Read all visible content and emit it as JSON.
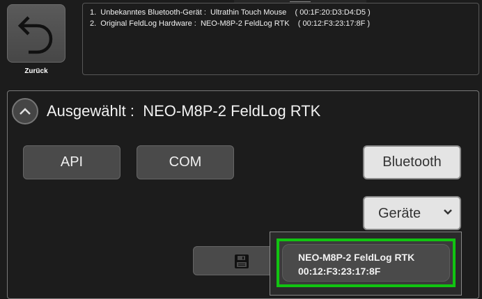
{
  "header": {
    "back_label": "Zurück"
  },
  "device_list": {
    "lines": [
      "1.  Unbekanntes Bluetooth-Gerät :  Ultrathin Touch Mouse    ( 00:1F:20:D3:D4:D5 )",
      "2.  Original FeldLog Hardware :  NEO-M8P-2 FeldLog RTK    ( 00:12:F3:23:17:8F )"
    ]
  },
  "selection": {
    "title": "Ausgewählt :  NEO-M8P-2 FeldLog RTK"
  },
  "connection_buttons": {
    "api": "API",
    "com": "COM",
    "bluetooth": "Bluetooth"
  },
  "devices_dropdown": {
    "selected": "Geräte"
  },
  "dropdown_popup": {
    "items": [
      {
        "name": "NEO-M8P-2 FeldLog RTK",
        "address": "00:12:F3:23:17:8F"
      }
    ]
  },
  "icons": {
    "back": "undo-arrow-icon",
    "collapse": "chevron-up-icon",
    "dropdown": "chevron-down-icon",
    "save": "floppy-disk-icon"
  }
}
